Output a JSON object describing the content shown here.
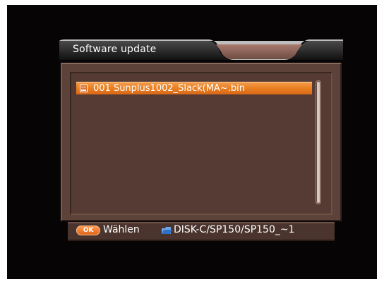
{
  "window": {
    "title": "Software update"
  },
  "file_list": {
    "items": [
      {
        "label": "001 Sunplus1002_Slack(MA~.bin",
        "icon": "file-icon",
        "selected": true
      }
    ],
    "scroll_fraction": 1.0
  },
  "footer": {
    "ok_key": "OK",
    "ok_action": "Wählen",
    "path_icon": "folder-icon",
    "path": "DISK-C/SP150/SP150_~1"
  },
  "colors": {
    "highlight": "#e77c1e",
    "panel": "#553b33",
    "background": "#060404"
  }
}
